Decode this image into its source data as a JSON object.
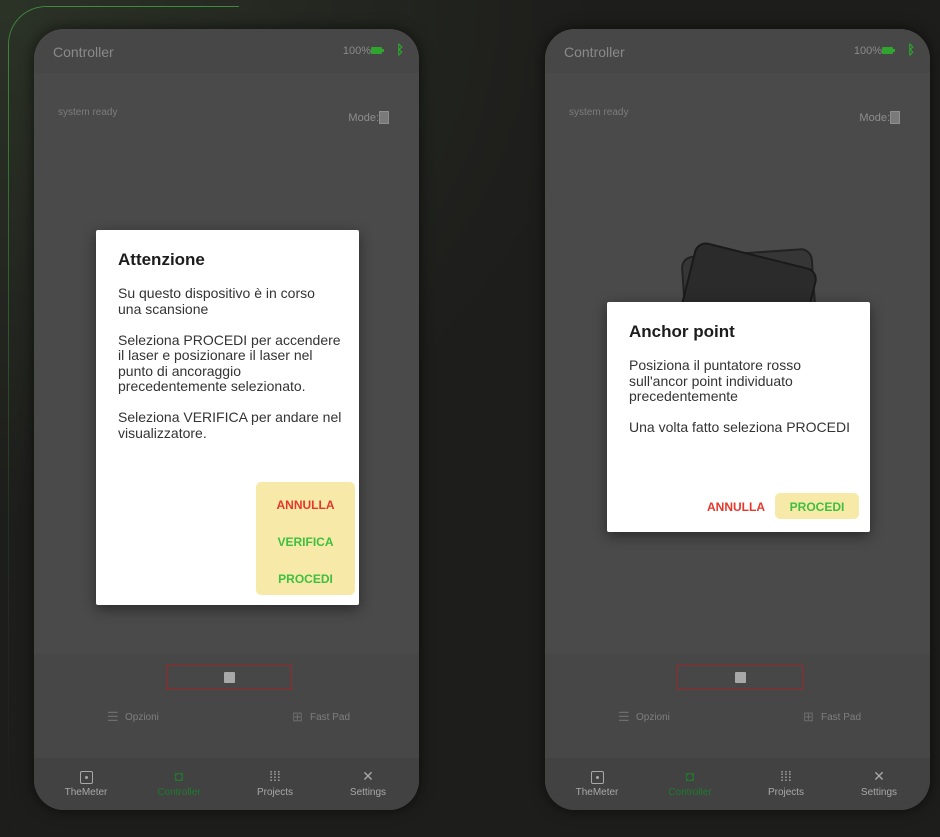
{
  "screens": [
    {
      "status_bar": {
        "title": "Controller",
        "battery": "100%"
      },
      "main": {
        "system_status": "system ready",
        "mode_label": "Mode:"
      },
      "dialog": {
        "title": "Attenzione",
        "body": "Su questo dispositivo è in corso una scansione\n\nSeleziona PROCEDI per accendere il laser e posizionare il laser nel punto di ancoraggio precedentemente selezionato.\n\nSeleziona VERIFICA per andare nel visualizzatore.",
        "actions": [
          "ANNULLA",
          "VERIFICA",
          "PROCEDI"
        ]
      },
      "controls": {
        "options": "Opzioni",
        "fast_pad": "Fast Pad"
      },
      "nav": [
        "TheMeter",
        "Controller",
        "Projects",
        "Settings"
      ]
    },
    {
      "status_bar": {
        "title": "Controller",
        "battery": "100%"
      },
      "main": {
        "system_status": "system ready",
        "mode_label": "Mode:"
      },
      "dialog": {
        "title": "Anchor point",
        "body": "Posiziona il puntatore rosso sull'ancor point individuato precedentemente\n\nUna volta fatto seleziona PROCEDI",
        "actions": [
          "ANNULLA",
          "PROCEDI"
        ]
      },
      "controls": {
        "options": "Opzioni",
        "fast_pad": "Fast Pad"
      },
      "nav": [
        "TheMeter",
        "Controller",
        "Projects",
        "Settings"
      ]
    }
  ],
  "colors": {
    "cancel": "#e5372b",
    "confirm": "#3fbf3f",
    "action_highlight": "#f7eaa9",
    "nav_active": "#1f7a2e",
    "bluetooth": "#2ca82c",
    "battery": "#2fa52f",
    "stop_border": "#9a2828"
  },
  "icons": {
    "status_bar": [
      "battery-icon",
      "bluetooth-icon"
    ],
    "mode": "device-icon",
    "controls": [
      "stop-icon",
      "sliders-icon",
      "grid-icon"
    ],
    "nav": [
      "themeter-icon",
      "gamepad-icon",
      "dots-grid-icon",
      "tools-icon"
    ]
  }
}
